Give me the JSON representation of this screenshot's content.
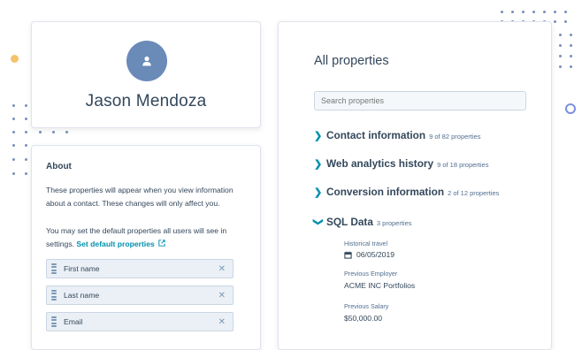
{
  "contact": {
    "name": "Jason Mendoza"
  },
  "about": {
    "title": "About",
    "description": "These properties will appear when you view information about a contact. These changes will only affect you.",
    "defaults_text": "You may set the default properties all users will see in settings.",
    "defaults_link": "Set default properties",
    "properties": [
      "First name",
      "Last name",
      "Email"
    ]
  },
  "all_properties": {
    "title": "All properties",
    "search_placeholder": "Search properties",
    "sections": [
      {
        "name": "Contact information",
        "count": "9 of 82 properties"
      },
      {
        "name": "Web analytics history",
        "count": "9 of 18 properties"
      },
      {
        "name": "Conversion information",
        "count": "2 of 12 properties"
      },
      {
        "name": "SQL Data",
        "count": "3 properties"
      }
    ],
    "sql_fields": [
      {
        "label": "Historical travel",
        "value": "06/05/2019"
      },
      {
        "label": "Previous Employer",
        "value": "ACME INC Portfolios"
      },
      {
        "label": "Previous Salary",
        "value": "$50,000.00"
      }
    ]
  },
  "colors": {
    "accent": "#0091ae",
    "text": "#33475b",
    "avatar": "#6a8ab8",
    "pill_bg": "#eaf0f6",
    "yellow_dot": "#f5c26b",
    "ring": "#7b8fe0"
  },
  "icons": [
    "person-icon",
    "external-link-icon",
    "drag-handle-icon",
    "close-icon",
    "chevron-right-icon",
    "chevron-down-icon",
    "calendar-icon"
  ]
}
